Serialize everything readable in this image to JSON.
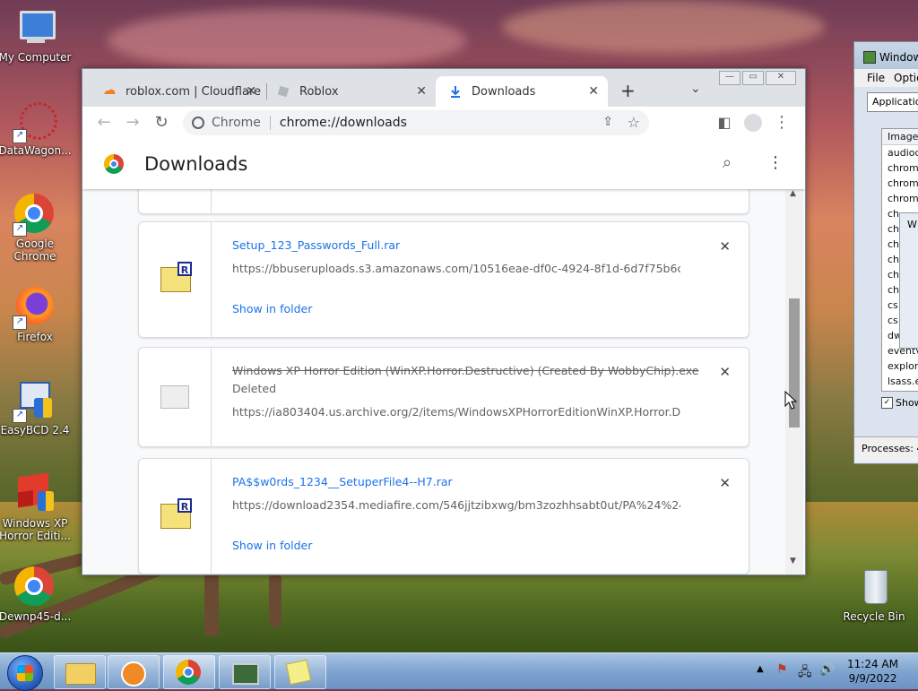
{
  "desktop": {
    "icons": [
      {
        "label": "My Computer",
        "icon": "computer-icon"
      },
      {
        "label": "DataWagon...",
        "icon": "datawagon-icon"
      },
      {
        "label": "Google Chrome",
        "icon": "chrome-icon"
      },
      {
        "label": "Firefox",
        "icon": "firefox-icon"
      },
      {
        "label": "EasyBCD 2.4",
        "icon": "easybcd-icon"
      },
      {
        "label": "Windows XP Horror Editi...",
        "icon": "winxp-horror-icon"
      },
      {
        "label": "Dewnp45-d...",
        "icon": "chrome-icon"
      },
      {
        "label": "Recycle Bin",
        "icon": "recycle-bin-icon"
      }
    ]
  },
  "browser": {
    "tabs": [
      {
        "label": "roblox.com | Cloudflare",
        "icon": "cloudflare-icon",
        "active": false
      },
      {
        "label": "Roblox",
        "icon": "roblox-icon",
        "active": false
      },
      {
        "label": "Downloads",
        "icon": "download-icon",
        "active": true
      }
    ],
    "omnibox": {
      "site": "Chrome",
      "url": "chrome://downloads"
    },
    "page_title": "Downloads",
    "downloads": [
      {
        "filename": "Setup_123_Passwords_Full.rar",
        "url": "https://bbuseruploads.s3.amazonaws.com/10516eae-df0c-4924-8f1d-6d7f75b6cd2...",
        "action": "Show in folder",
        "deleted": false,
        "status": ""
      },
      {
        "filename": "Windows XP Horror Edition (WinXP.Horror.Destructive) (Created By WobbyChip).exe",
        "url": "https://ia803404.us.archive.org/2/items/WindowsXPHorrorEditionWinXP.Horror.Dest...",
        "action": "",
        "deleted": true,
        "status": "Deleted"
      },
      {
        "filename": "PA$$w0rds_1234__SetuperFile4--H7.rar",
        "url": "https://download2354.mediafire.com/546jjtzibxwg/bm3zozhhsabt0ut/PA%24%24w0...",
        "action": "Show in folder",
        "deleted": false,
        "status": ""
      }
    ]
  },
  "task_manager": {
    "title": "Window",
    "menu": [
      "File",
      "Optio"
    ],
    "tab": "Application",
    "column": "Image",
    "processes": [
      "audiodg",
      "chrome",
      "chrome",
      "chrome",
      "ch",
      "ch",
      "ch",
      "ch",
      "ch",
      "ch",
      "cs",
      "cs",
      "dw",
      "eventv",
      "explore",
      "lsass.e"
    ],
    "show_label": "Show",
    "status": "Processes: 4"
  },
  "taskbar": {
    "time": "11:24 AM",
    "date": "9/9/2022"
  }
}
